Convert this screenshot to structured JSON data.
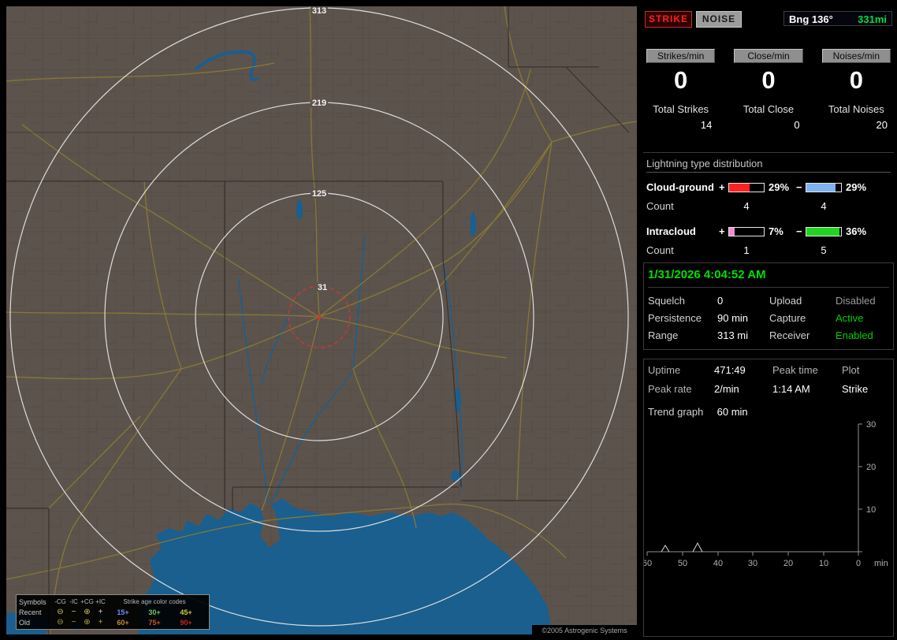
{
  "map": {
    "rings": {
      "r313": "313",
      "r219": "219",
      "r125": "125",
      "r31": "31"
    },
    "copyright": "©2005 Astrogenic Systems",
    "legend": {
      "symbols_header": "Symbols",
      "columns": {
        "neg_cg": "-CG",
        "neg_ic": "-IC",
        "pos_cg": "+CG",
        "pos_ic": "+IC"
      },
      "age_header": "Strike age color codes",
      "recent_label": "Recent",
      "old_label": "Old",
      "sym_circle_minus": "⊖",
      "sym_minus": "−",
      "sym_circle_plus": "⊕",
      "sym_plus": "+",
      "recent_ages": {
        "a15": "15+",
        "a30": "30+",
        "a45": "45+"
      },
      "old_ages": {
        "a60": "60+",
        "a75": "75+",
        "a90": "90+"
      },
      "age_colors": {
        "a15": "#6f8cff",
        "a30": "#66cc66",
        "a45": "#cccc44",
        "a60": "#cc8833",
        "a75": "#cc5522",
        "a90": "#cc2222"
      }
    }
  },
  "panel": {
    "strike_button": "STRIKE",
    "noise_button": "NOISE",
    "bearing": {
      "label": "Bng 136°",
      "distance": "331mi"
    },
    "rates": {
      "strikes": {
        "label": "Strikes/min",
        "value": "0",
        "total_label": "Total Strikes",
        "total": "14"
      },
      "close": {
        "label": "Close/min",
        "value": "0",
        "total_label": "Total Close",
        "total": "0"
      },
      "noises": {
        "label": "Noises/min",
        "value": "0",
        "total_label": "Total Noises",
        "total": "20"
      }
    },
    "distribution": {
      "title": "Lightning type distribution",
      "cloud_ground": {
        "label": "Cloud-ground",
        "plus_sign": "+",
        "minus_sign": "−",
        "plus_pct": "29%",
        "minus_pct": "29%",
        "plus_fill": "60%",
        "minus_fill": "85%",
        "plus_color": "#ff2222",
        "minus_color": "#7fb2f0",
        "count_label": "Count",
        "plus_count": "4",
        "minus_count": "4"
      },
      "intracloud": {
        "label": "Intracloud",
        "plus_sign": "+",
        "minus_sign": "−",
        "plus_pct": "7%",
        "minus_pct": "36%",
        "plus_fill": "17%",
        "minus_fill": "96%",
        "plus_color": "#f08fd0",
        "minus_color": "#22d422",
        "count_label": "Count",
        "plus_count": "1",
        "minus_count": "5"
      }
    },
    "datetime": "1/31/2026 4:04:52 AM",
    "settings": {
      "squelch_label": "Squelch",
      "squelch": "0",
      "persistence_label": "Persistence",
      "persistence": "90 min",
      "range_label": "Range",
      "range": "313 mi",
      "upload_label": "Upload",
      "upload": "Disabled",
      "capture_label": "Capture",
      "capture": "Active",
      "receiver_label": "Receiver",
      "receiver": "Enabled"
    },
    "status": {
      "uptime_label": "Uptime",
      "uptime": "471:49",
      "peak_time_label": "Peak time",
      "peak_time": "1:14 AM",
      "plot_label": "Plot",
      "plot": "Strike",
      "peak_rate_label": "Peak rate",
      "peak_rate": "2/min",
      "trend_label": "Trend graph",
      "trend_window": "60 min"
    },
    "trend_graph": {
      "type": "line",
      "y_ticks": {
        "t30": "30",
        "t20": "20",
        "t10": "10"
      },
      "x_ticks": {
        "t60": "60",
        "t50": "50",
        "t40": "40",
        "t30": "30",
        "t20": "20",
        "t10": "10",
        "t0": "0"
      },
      "unit": "min",
      "ylim": [
        0,
        30
      ],
      "xlim_minutes_ago": [
        60,
        0
      ],
      "spikes": [
        {
          "minutes_ago": 55,
          "rate": 1
        },
        {
          "minutes_ago": 46,
          "rate": 2
        }
      ]
    }
  }
}
